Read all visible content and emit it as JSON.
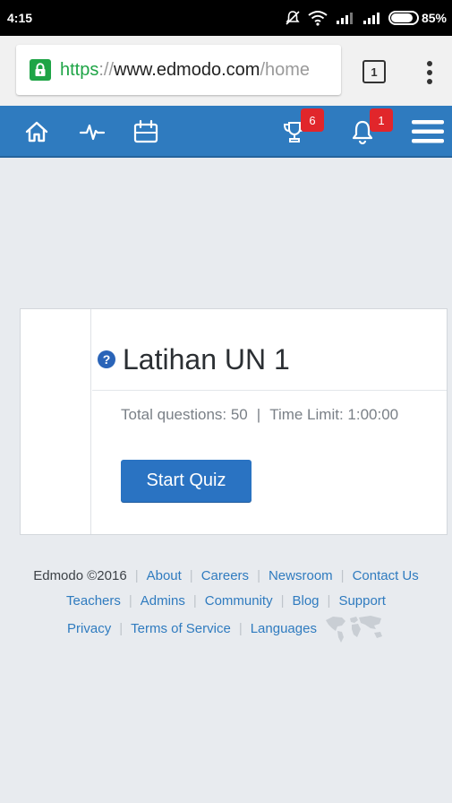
{
  "status_bar": {
    "time": "4:15",
    "battery_percent": "85%",
    "battery_level": 0.85
  },
  "browser": {
    "url_scheme": "https",
    "url_separator": "://",
    "url_host": "www.edmodo.com",
    "url_path": "/home",
    "tab_count": "1"
  },
  "nav": {
    "trophy_badge": "6",
    "notifications_badge": "1",
    "icons": [
      "home-icon",
      "activity-icon",
      "planner-icon",
      "trophy-icon",
      "bell-icon",
      "hamburger-menu-icon"
    ]
  },
  "quiz": {
    "title": "Latihan UN 1",
    "icon_glyph": "?",
    "total_questions": "Total questions: 50",
    "separator": "|",
    "time_limit": "Time Limit: 1:00:00",
    "start_button": "Start Quiz"
  },
  "footer": {
    "copyright": "Edmodo ©2016",
    "row1_links": [
      "About",
      "Careers",
      "Newsroom",
      "Contact Us"
    ],
    "row2_links": [
      "Teachers",
      "Admins",
      "Community",
      "Blog",
      "Support"
    ],
    "row3_links": [
      "Privacy",
      "Terms of Service",
      "Languages"
    ]
  },
  "colors": {
    "nav_blue": "#2f7bbf",
    "button_blue": "#2a73c2",
    "badge_red": "#e1262b",
    "secure_green": "#1ea446",
    "page_bg": "#e8ebef"
  }
}
